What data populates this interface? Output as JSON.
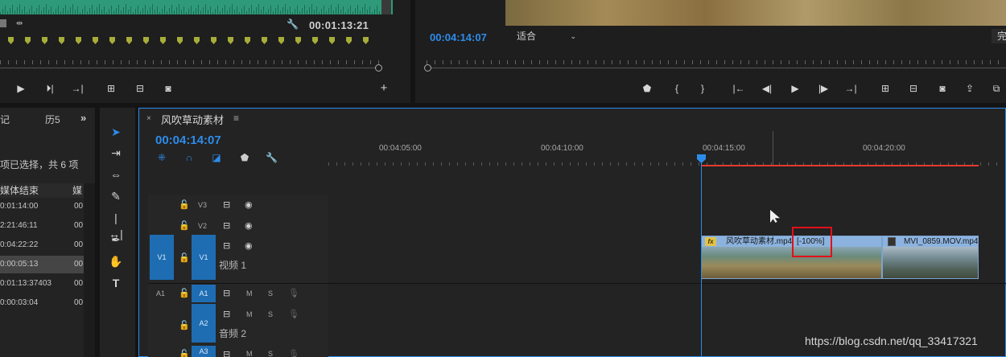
{
  "source_monitor": {
    "timecode": "00:01:13:21"
  },
  "program_monitor": {
    "timecode": "00:04:14:07",
    "fit_value": "适合",
    "full_label": "完"
  },
  "project_panel": {
    "tab_1": "记",
    "tab_2": "历5",
    "more": "»",
    "selection_info": "项已选择，共 6 项",
    "column_end": "媒体结束",
    "column_media": "媒",
    "rows": [
      {
        "end": "0:01:14:00",
        "media": "00"
      },
      {
        "end": "2:21:46:11",
        "media": "00"
      },
      {
        "end": "0:04:22:22",
        "media": "00"
      },
      {
        "end": "0:00:05:13",
        "media": "00"
      },
      {
        "end": "0:01:13:37403",
        "media": "00"
      },
      {
        "end": "0:00:03:04",
        "media": "00"
      }
    ]
  },
  "timeline": {
    "close": "×",
    "title": "风吹草动素材",
    "menu": "≡",
    "timecode": "00:04:14:07",
    "ruler_labels": [
      "00:04:05:00",
      "00:04:10:00",
      "00:04:15:00",
      "00:04:20:00"
    ],
    "tracks": {
      "v3": "V3",
      "v2": "V2",
      "v1_src": "V1",
      "v1": "V1",
      "video_1": "视频 1",
      "a1_src": "A1",
      "a1": "A1",
      "a2": "A2",
      "audio_2": "音频 2",
      "a3": "A3",
      "m": "M",
      "s": "S"
    },
    "clips": [
      {
        "name": "风吹草动素材.mp4",
        "speed": "[-100%]"
      },
      {
        "name": "MVI_0859.MOV.mp4"
      }
    ]
  },
  "watermark": "https://blog.csdn.net/qq_33417321"
}
